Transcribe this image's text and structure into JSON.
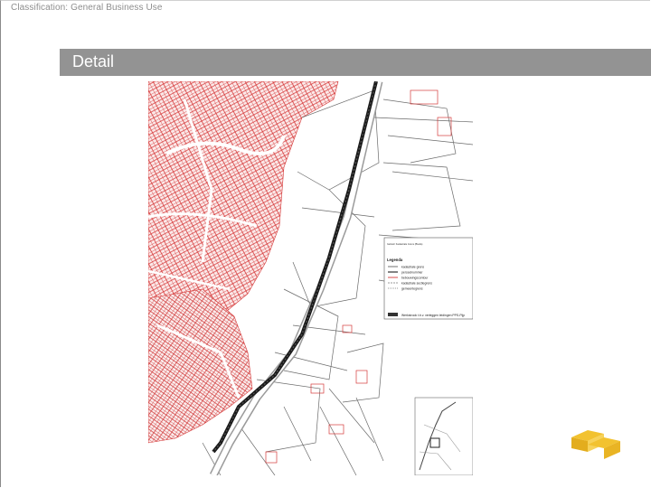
{
  "header": {
    "classification": "Classification: General Business Use"
  },
  "slide": {
    "title": "Detail"
  },
  "map": {
    "legend": {
      "heading": "Legenda",
      "info_line": "Gebied: Kadastrale Grens (Breda)",
      "items": [
        "kadastrale grens",
        "perceelnummer",
        "bebouwingscontour",
        "kadastrale sectiegrens",
        "gemeentegrens"
      ],
      "project_line": "Werkstrook t.b.v. verleggen leidingen PPS-Pijp"
    }
  },
  "colors": {
    "title_bar": "#939393",
    "parcel_red": "#d63a3a",
    "logo_gold": "#f2c230",
    "logo_text": "#3b3f8f"
  }
}
